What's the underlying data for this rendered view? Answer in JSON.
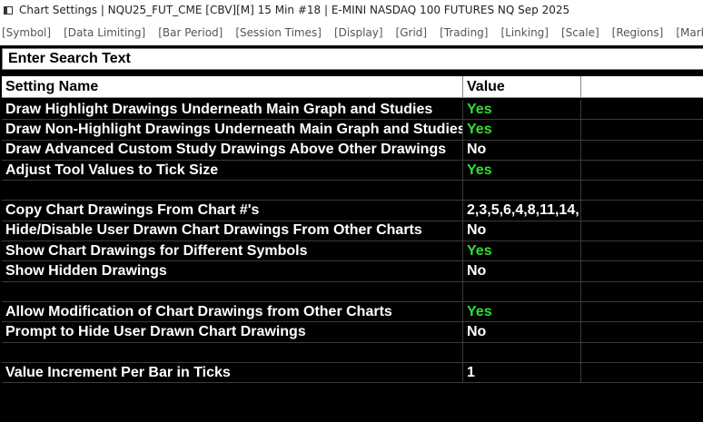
{
  "window": {
    "title": "Chart Settings | NQU25_FUT_CME [CBV][M]  15 Min  #18 | E-MINI NASDAQ 100 FUTURES NQ Sep 2025"
  },
  "tabs": [
    "[Symbol]",
    "[Data Limiting]",
    "[Bar Period]",
    "[Session Times]",
    "[Display]",
    "[Grid]",
    "[Trading]",
    "[Linking]",
    "[Scale]",
    "[Regions]",
    "[Market Depth]",
    "["
  ],
  "search": {
    "placeholder": "Enter Search Text"
  },
  "columns": {
    "name": "Setting Name",
    "value": "Value"
  },
  "colors": {
    "yes": "#33dd33",
    "background": "#000000"
  },
  "rows": [
    {
      "name": "Draw Highlight Drawings Underneath Main Graph and Studies",
      "value": "Yes"
    },
    {
      "name": "Draw Non-Highlight Drawings Underneath Main Graph and Studies",
      "value": "Yes"
    },
    {
      "name": "Draw Advanced Custom Study Drawings Above Other Drawings",
      "value": "No"
    },
    {
      "name": "Adjust Tool Values to Tick Size",
      "value": "Yes"
    },
    {
      "name": "",
      "value": ""
    },
    {
      "name": "Copy Chart Drawings From Chart #'s",
      "value": "2,3,5,6,4,8,11,14,"
    },
    {
      "name": "Hide/Disable User Drawn Chart Drawings From Other Charts",
      "value": "No"
    },
    {
      "name": "Show Chart Drawings for Different Symbols",
      "value": "Yes"
    },
    {
      "name": "Show Hidden Drawings",
      "value": "No"
    },
    {
      "name": "",
      "value": ""
    },
    {
      "name": "Allow Modification of Chart Drawings from Other Charts",
      "value": "Yes"
    },
    {
      "name": "Prompt to Hide User Drawn Chart Drawings",
      "value": "No"
    },
    {
      "name": "",
      "value": ""
    },
    {
      "name": "Value Increment Per Bar in Ticks",
      "value": "1"
    }
  ]
}
